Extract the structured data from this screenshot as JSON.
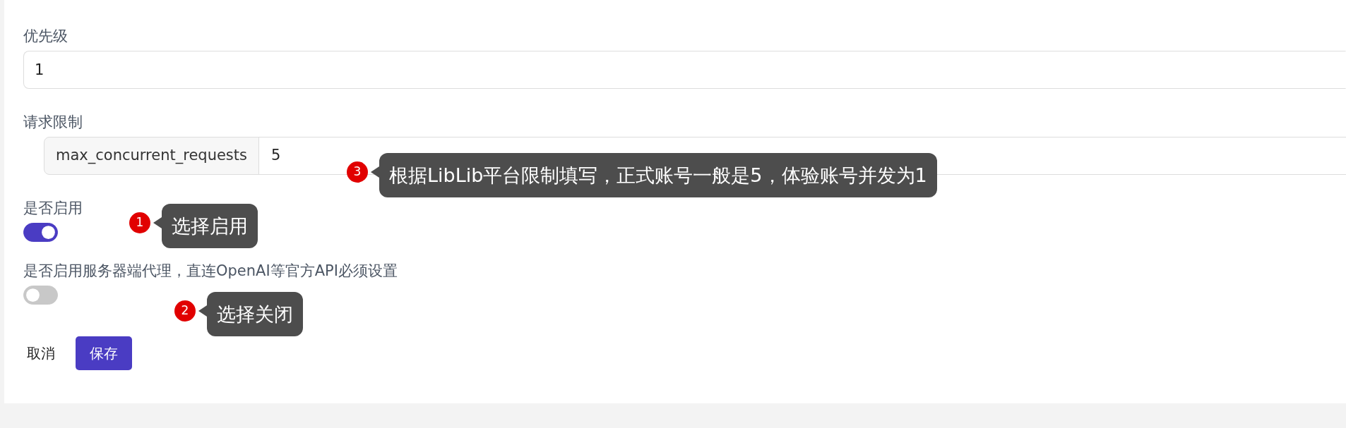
{
  "fields": [
    {
      "kind": "text",
      "label": "优先级",
      "value": "1"
    },
    {
      "kind": "addon",
      "label": "请求限制",
      "addon": "max_concurrent_requests",
      "value": "5",
      "callout": {
        "number": "3",
        "text": "根据LibLib平台限制填写，正式账号一般是5，体验账号并发为1"
      }
    },
    {
      "kind": "switch",
      "label": "是否启用",
      "on": true,
      "callout": {
        "number": "1",
        "text": "选择启用"
      }
    },
    {
      "kind": "switch",
      "label": "是否启用服务器端代理，直连OpenAI等官方API必须设置",
      "on": false,
      "callout": {
        "number": "2",
        "text": "选择关闭"
      }
    }
  ],
  "buttons": [
    {
      "kind": "link",
      "label": "取消"
    },
    {
      "kind": "primary",
      "label": "保存"
    }
  ]
}
